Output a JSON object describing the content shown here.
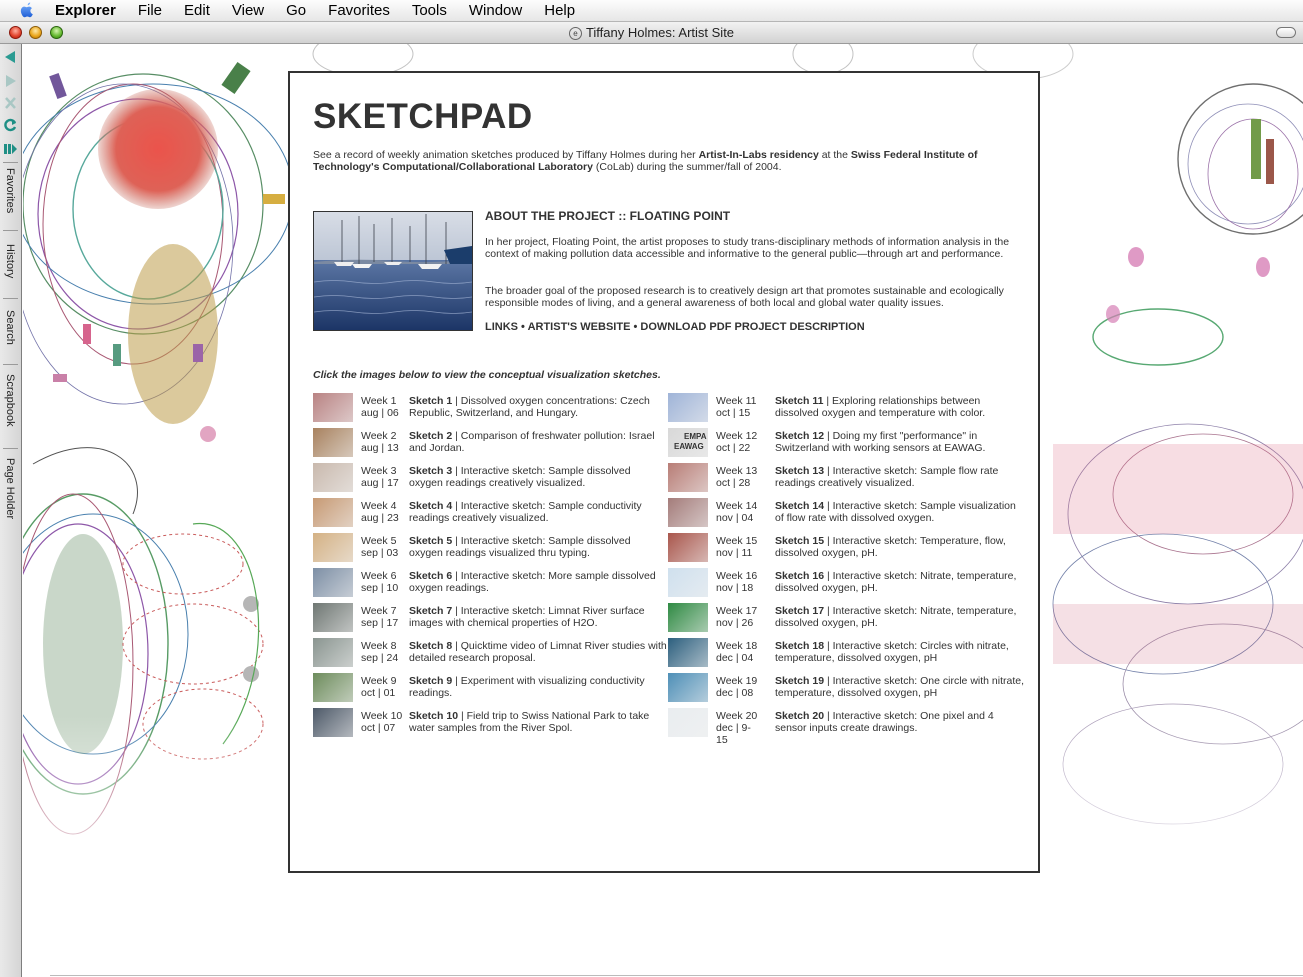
{
  "menubar": {
    "items": [
      "Explorer",
      "File",
      "Edit",
      "View",
      "Go",
      "Favorites",
      "Tools",
      "Window",
      "Help"
    ]
  },
  "window": {
    "title": "Tiffany Holmes: Artist Site"
  },
  "explorer_bar": {
    "tabs": [
      "Favorites",
      "History",
      "Search",
      "Scrapbook",
      "Page Holder"
    ]
  },
  "page": {
    "title": "SKETCHPAD",
    "intro": {
      "t1": "See a record of weekly animation sketches produced by Tiffany Holmes during her ",
      "b1": "Artist-In-Labs residency",
      "t2": " at the ",
      "b2": "Swiss Federal Institute of Technology's Computational/Collaborational Laboratory",
      "t3": " (CoLab) during the summer/fall of 2004."
    },
    "about": {
      "heading": "ABOUT THE PROJECT :: FLOATING POINT",
      "p1": "In her project, Floating Point, the artist proposes to study trans-disciplinary methods of information analysis in the context of making pollution data accessible and informative to the general public—through art and performance.",
      "p2": "The broader goal of the proposed research is to creatively design art that promotes sustainable and ecologically responsible modes of living, and a general awareness of both local and global water quality issues.",
      "links": [
        "LINKS",
        "ARTIST'S WEBSITE",
        "DOWNLOAD PDF PROJECT DESCRIPTION"
      ],
      "separator": " • "
    },
    "instruction": "Click the images below to view the conceptual visualization sketches.",
    "sketches_left": [
      {
        "week": "Week 1",
        "date": "aug | 06",
        "title": "Sketch 1",
        "desc": " | Dissolved oxygen concentrations: Czech Republic, Switzerland, and Hungary.",
        "thumb": "#b98383"
      },
      {
        "week": "Week 2",
        "date": "aug | 13",
        "title": "Sketch 2",
        "desc": " | Comparison of freshwater pollution: Israel and Jordan.",
        "thumb": "#a8825f"
      },
      {
        "week": "Week 3",
        "date": "aug | 17",
        "title": "Sketch 3",
        "desc": " | Interactive sketch: Sample dissolved oxygen readings creatively visualized.",
        "thumb": "#c9b9ad"
      },
      {
        "week": "Week 4",
        "date": "aug | 23",
        "title": "Sketch 4",
        "desc": " | Interactive sketch: Sample conductivity readings creatively visualized.",
        "thumb": "#c79a74"
      },
      {
        "week": "Week 5",
        "date": "sep | 03",
        "title": "Sketch 5",
        "desc": " | Interactive sketch: Sample dissolved oxygen readings visualized thru typing.",
        "thumb": "#d4b184"
      },
      {
        "week": "Week 6",
        "date": "sep | 10",
        "title": "Sketch 6",
        "desc": " | Interactive sketch: More sample dissolved oxygen readings.",
        "thumb": "#7d8fa5"
      },
      {
        "week": "Week 7",
        "date": "sep | 17",
        "title": "Sketch 7",
        "desc": " | Interactive sketch: Limnat River surface images with chemical properties of H2O.",
        "thumb": "#6f7773"
      },
      {
        "week": "Week 8",
        "date": "sep | 24",
        "title": "Sketch 8",
        "desc": " | Quicktime video of Limnat River studies with detailed research proposal.",
        "thumb": "#8a9590"
      },
      {
        "week": "Week 9",
        "date": "oct | 01",
        "title": "Sketch 9",
        "desc": " | Experiment with visualizing conductivity readings.",
        "thumb": "#6d8c5c"
      },
      {
        "week": "Week 10",
        "date": "oct | 07",
        "title": "Sketch 10",
        "desc": " | Field trip to Swiss National Park to take water samples from the River Spol.",
        "thumb": "#4d5968"
      }
    ],
    "sketches_right": [
      {
        "week": "Week 11",
        "date": "oct | 15",
        "title": "Sketch 11",
        "desc": " | Exploring relationships between dissolved oxygen and temperature with color.",
        "thumb": "#9fb4d8"
      },
      {
        "week": "Week 12",
        "date": "oct | 22",
        "title": "Sketch 12",
        "desc": " | Doing my first \"performance\" in Switzerland with working sensors at EAWAG.",
        "thumb": "#d8d8d8",
        "thumb_text": [
          "EMPA",
          "EAWAG"
        ]
      },
      {
        "week": "Week 13",
        "date": "oct | 28",
        "title": "Sketch 13",
        "desc": " | Interactive sketch: Sample flow rate readings creatively visualized.",
        "thumb": "#b87d76"
      },
      {
        "week": "Week 14",
        "date": "nov | 04",
        "title": "Sketch 14",
        "desc": " | Interactive sketch: Sample visualization of flow rate with dissolved oxygen.",
        "thumb": "#a47c7a"
      },
      {
        "week": "Week 15",
        "date": "nov | 11",
        "title": "Sketch 15",
        "desc": " | Interactive sketch: Temperature, flow, dissolved oxygen, pH.",
        "thumb": "#a9564c"
      },
      {
        "week": "Week 16",
        "date": "nov | 18",
        "title": "Sketch 16",
        "desc": " | Interactive sketch: Nitrate, temperature, dissolved oxygen, pH.",
        "thumb": "#cfe0ee"
      },
      {
        "week": "Week 17",
        "date": "nov | 26",
        "title": "Sketch 17",
        "desc": " | Interactive sketch: Nitrate, temperature, dissolved oxygen, pH.",
        "thumb": "#2f8a43"
      },
      {
        "week": "Week 18",
        "date": "dec | 04",
        "title": "Sketch 18",
        "desc": " | Interactive sketch: Circles with nitrate, temperature, dissolved oxygen, pH",
        "thumb": "#2c5f7e"
      },
      {
        "week": "Week 19",
        "date": "dec | 08",
        "title": "Sketch 19",
        "desc": " | Interactive sketch: One circle with nitrate, temperature, dissolved oxygen, pH",
        "thumb": "#4e8fb7"
      },
      {
        "week": "Week 20",
        "date": "dec | 9-15",
        "title": "Sketch 20",
        "desc": " | Interactive sketch: One pixel and 4 sensor inputs create drawings.",
        "thumb": "#e9edf0"
      }
    ]
  }
}
